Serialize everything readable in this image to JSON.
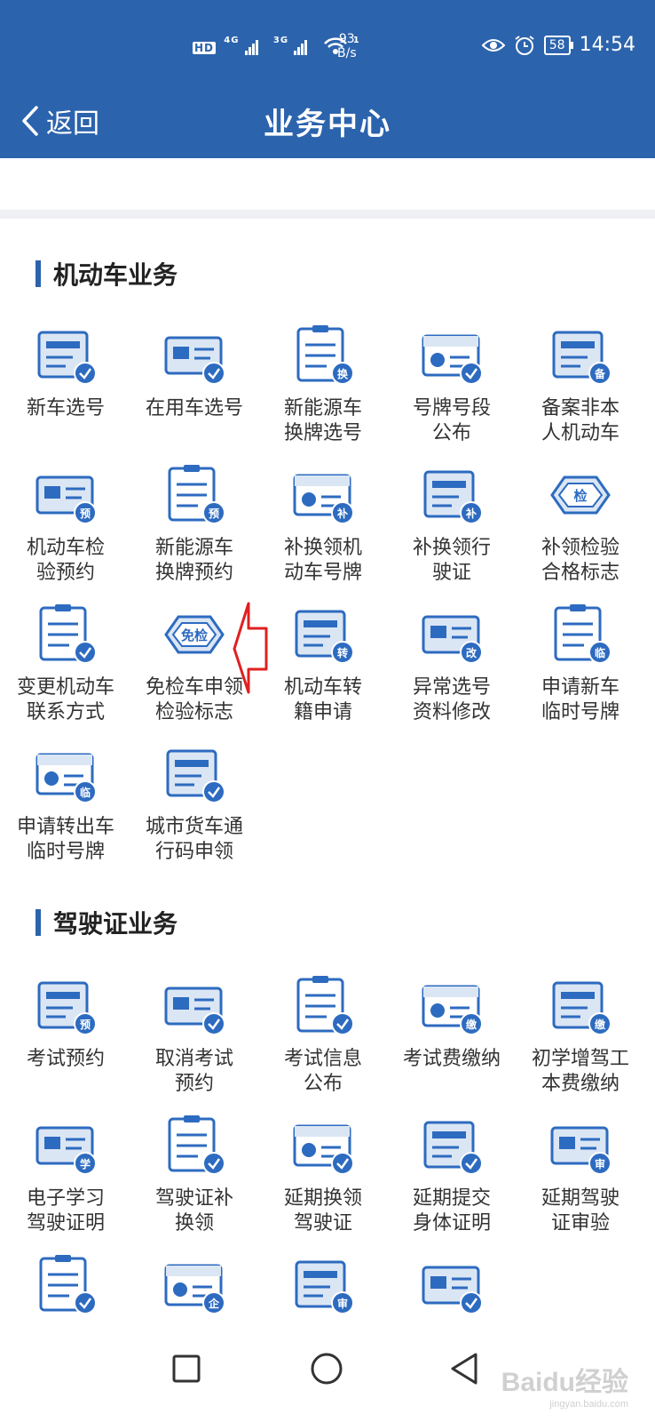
{
  "status_bar": {
    "network": "HD",
    "sim1": "4G",
    "sim2": "3G",
    "wifi_level": "1",
    "speed_value": "93",
    "speed_unit": "B/s",
    "battery": "58",
    "time": "14:54"
  },
  "navbar": {
    "back_label": "返回",
    "title": "业务中心"
  },
  "colors": {
    "primary": "#2c63ad",
    "icon_blue": "#2d6bc0",
    "icon_light": "#dbe6f4",
    "annotation_red": "#e02020"
  },
  "vehicle_section": {
    "title": "机动车业务",
    "items": [
      {
        "label": "新车选号",
        "icon": "plate-select-icon"
      },
      {
        "label": "在用车选号",
        "icon": "used-car-select-icon"
      },
      {
        "label": "新能源车\n换牌选号",
        "icon": "ev-plate-exchange-icon",
        "badge": "换"
      },
      {
        "label": "号牌号段\n公布",
        "icon": "plate-range-publish-icon"
      },
      {
        "label": "备案非本\n人机动车",
        "icon": "register-vehicle-icon",
        "badge": "备"
      },
      {
        "label": "机动车检\n验预约",
        "icon": "inspection-booking-icon",
        "badge": "预"
      },
      {
        "label": "新能源车\n换牌预约",
        "icon": "ev-plate-booking-icon",
        "badge": "预"
      },
      {
        "label": "补换领机\n动车号牌",
        "icon": "plate-replace-icon",
        "badge": "补"
      },
      {
        "label": "补换领行\n驶证",
        "icon": "license-replace-icon",
        "badge": "补"
      },
      {
        "label": "补领检验\n合格标志",
        "icon": "inspection-mark-icon",
        "badge": "检"
      },
      {
        "label": "变更机动车\n联系方式",
        "icon": "change-contact-icon"
      },
      {
        "label": "免检车申领\n检验标志",
        "icon": "exempt-mark-icon",
        "badge": "免检"
      },
      {
        "label": "机动车转\n籍申请",
        "icon": "vehicle-transfer-icon",
        "badge": "转"
      },
      {
        "label": "异常选号\n资料修改",
        "icon": "abnormal-select-icon",
        "badge": "改"
      },
      {
        "label": "申请新车\n临时号牌",
        "icon": "new-temp-plate-icon",
        "badge": "临"
      },
      {
        "label": "申请转出车\n临时号牌",
        "icon": "transfer-temp-plate-icon",
        "badge": "临"
      },
      {
        "label": "城市货车通\n行码申领",
        "icon": "truck-pass-icon"
      }
    ]
  },
  "license_section": {
    "title": "驾驶证业务",
    "items": [
      {
        "label": "考试预约",
        "icon": "exam-booking-icon",
        "badge": "预"
      },
      {
        "label": "取消考试\n预约",
        "icon": "exam-cancel-icon"
      },
      {
        "label": "考试信息\n公布",
        "icon": "exam-info-icon"
      },
      {
        "label": "考试费缴纳",
        "icon": "exam-fee-icon",
        "badge": "缴"
      },
      {
        "label": "初学增驾工\n本费缴纳",
        "icon": "learner-fee-icon",
        "badge": "缴"
      },
      {
        "label": "电子学习\n驾驶证明",
        "icon": "e-learning-permit-icon",
        "badge": "学"
      },
      {
        "label": "驾驶证补\n换领",
        "icon": "license-reissue-icon"
      },
      {
        "label": "延期换领\n驾驶证",
        "icon": "delay-renew-icon"
      },
      {
        "label": "延期提交\n身体证明",
        "icon": "delay-health-icon"
      },
      {
        "label": "延期驾驶\n证审验",
        "icon": "delay-review-icon",
        "badge": "审"
      },
      {
        "label": "",
        "icon": "phone-change-icon"
      },
      {
        "label": "",
        "icon": "enterprise-icon",
        "badge": "企"
      },
      {
        "label": "",
        "icon": "review-doc-icon",
        "badge": "审"
      },
      {
        "label": "",
        "icon": "e-license-icon"
      }
    ]
  },
  "bottom_nav": {
    "watermark": "Baidu经验",
    "watermark_sub": "jingyan.baidu.com"
  }
}
